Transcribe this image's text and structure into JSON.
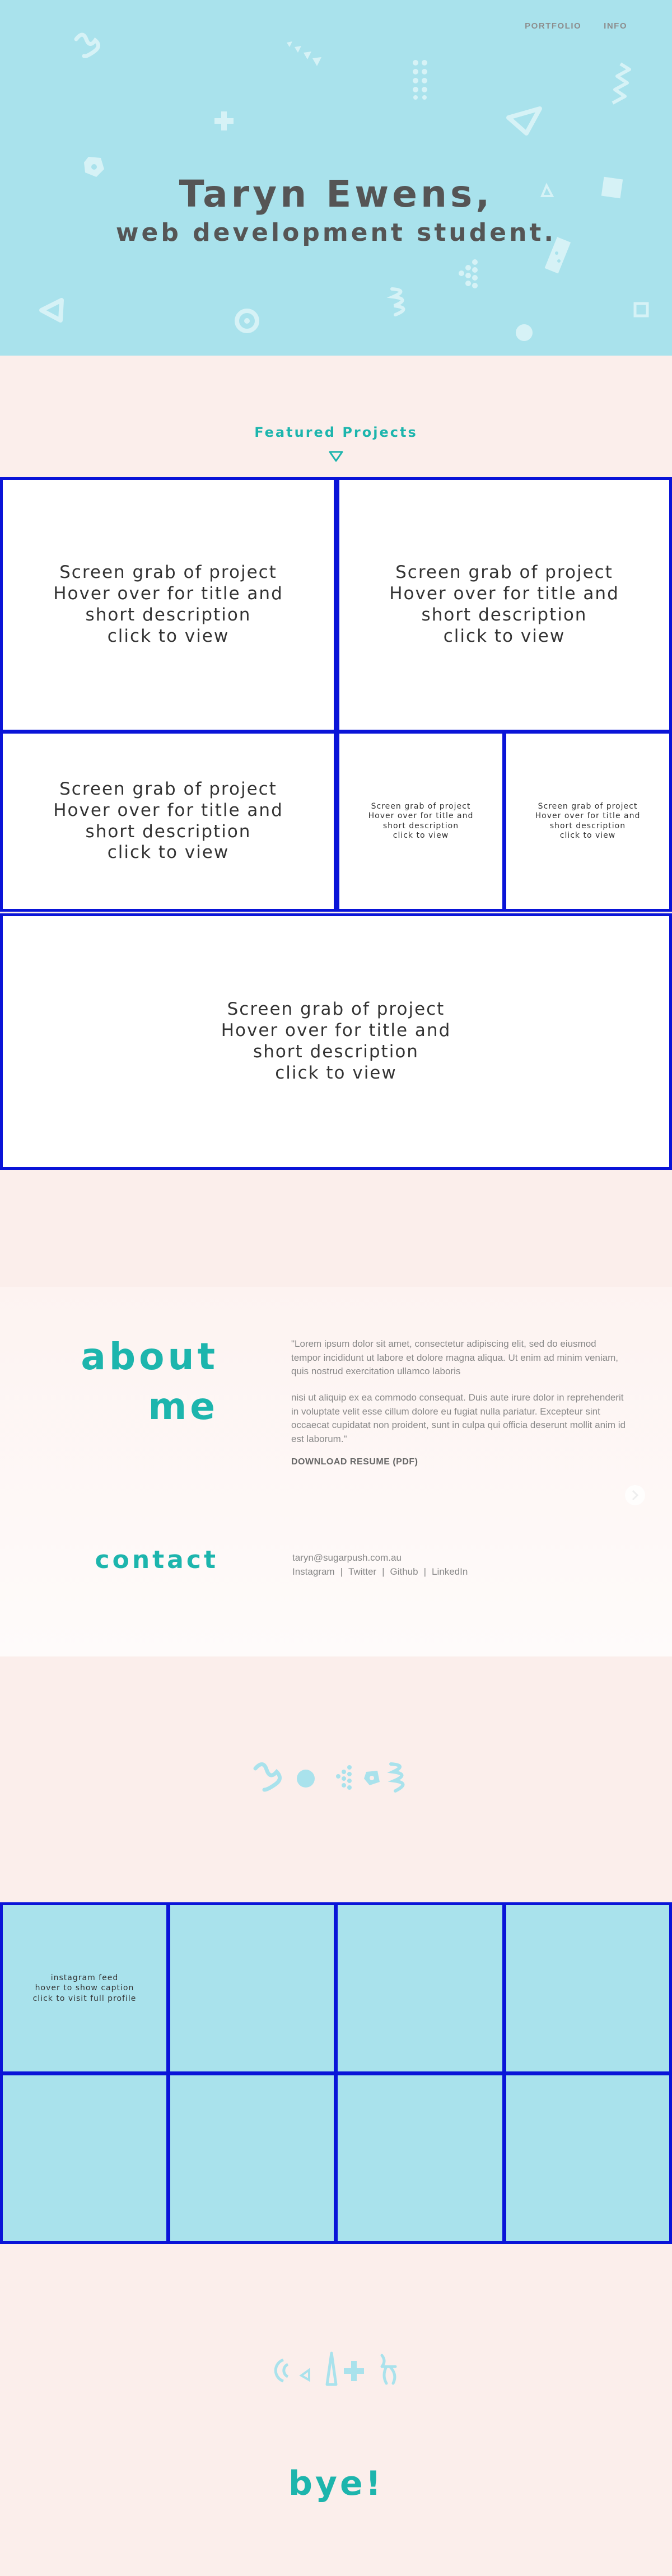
{
  "nav": {
    "items": [
      "PORTFOLIO",
      "INFO"
    ]
  },
  "hero": {
    "title": "Taryn Ewens,",
    "subtitle": "web development student."
  },
  "featured": {
    "title": "Featured Projects",
    "project_lines": [
      "Screen grab of project",
      "Hover over for title and",
      "short description",
      "click to view"
    ]
  },
  "about": {
    "heading_line1": "about",
    "heading_line2": "me",
    "paragraph1": "\"Lorem ipsum dolor sit amet, consectetur adipiscing elit, sed do eiusmod tempor incididunt ut labore et dolore magna aliqua. Ut enim ad minim veniam, quis nostrud exercitation ullamco laboris",
    "paragraph2": "nisi ut aliquip ex ea commodo consequat. Duis aute irure dolor in reprehenderit in voluptate velit esse cillum dolore eu fugiat nulla pariatur. Excepteur sint occaecat cupidatat non proident, sunt in culpa qui officia deserunt mollit anim id est laborum.\"",
    "resume_link": "DOWNLOAD RESUME (PDF)"
  },
  "contact": {
    "heading": "contact",
    "email": "taryn@sugarpush.com.au",
    "links": [
      "Instagram",
      "Twitter",
      "Github",
      "LinkedIn"
    ],
    "separator": "|"
  },
  "instagram": {
    "caption_lines": [
      "instagram feed",
      "hover to show caption",
      "click to visit full profile"
    ]
  },
  "footer": {
    "bye": "bye!"
  },
  "colors": {
    "hero_bg": "#a9e2ec",
    "accent": "#1db5ad",
    "border": "#0a14d8",
    "page_bg": "#fbeeeb"
  }
}
